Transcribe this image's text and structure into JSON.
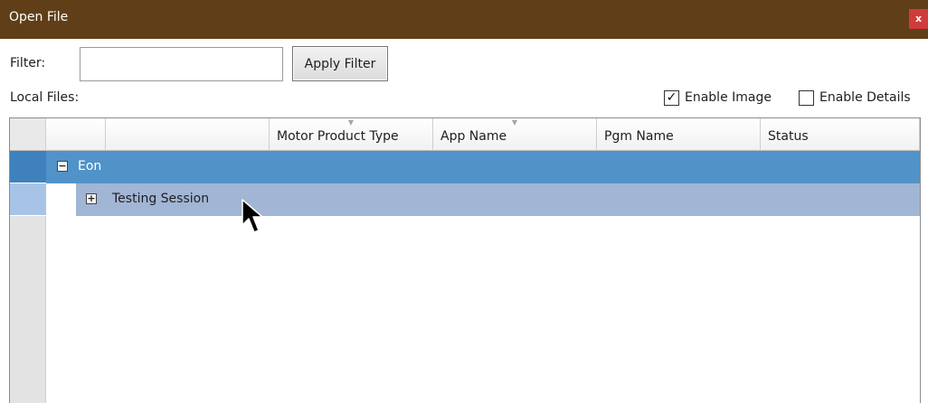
{
  "window": {
    "title": "Open File",
    "close_label": "x"
  },
  "filter": {
    "label": "Filter:",
    "value": "",
    "apply_label": "Apply Filter"
  },
  "local_files_label": "Local Files:",
  "options": {
    "enable_image": {
      "label": "Enable Image",
      "checked": true,
      "mark": "✓"
    },
    "enable_details": {
      "label": "Enable Details",
      "checked": false,
      "mark": ""
    }
  },
  "grid": {
    "columns": [
      "",
      "",
      "Motor Product Type",
      "App Name",
      "Pgm Name",
      "Status"
    ],
    "sort_glyph": "▼",
    "rows": [
      {
        "name": "Eon",
        "expander": "−",
        "expanded": true,
        "selected": true
      },
      {
        "name": "Testing Session",
        "expander": "+",
        "expanded": false,
        "selected": false
      }
    ]
  },
  "colors": {
    "titlebar": "#603f18",
    "close_button": "#d03b3b",
    "selected_row": "#5193c9",
    "child_row": "#a1b5d5"
  }
}
